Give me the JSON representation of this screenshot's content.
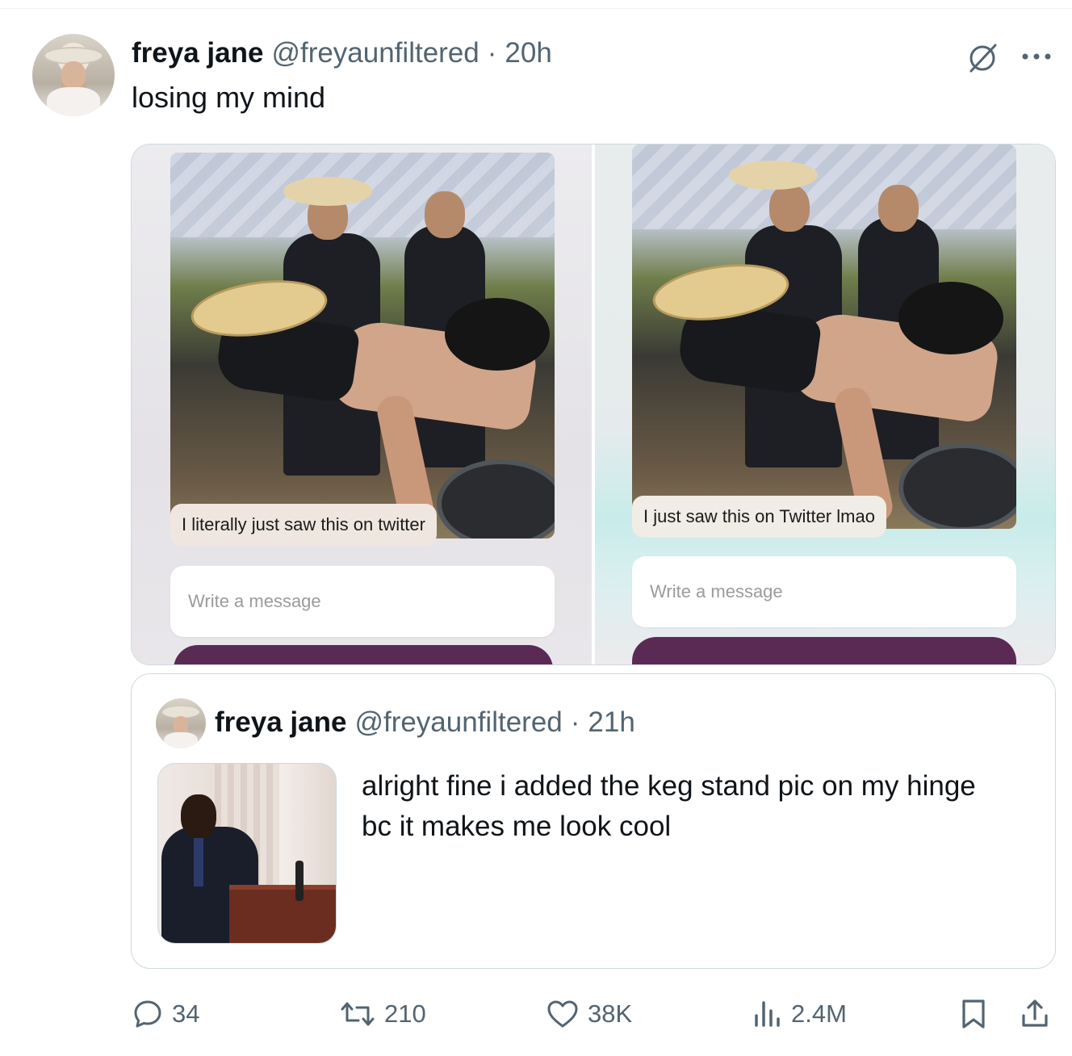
{
  "tweet": {
    "author_name": "freya jane",
    "handle": "@freyaunfiltered",
    "separator": "·",
    "time": "20h",
    "text": "losing my mind"
  },
  "media": {
    "left": {
      "bubble": "I literally just saw this on twitter",
      "input_placeholder": "Write a message"
    },
    "right": {
      "bubble": "I just saw this on Twitter lmao",
      "input_placeholder": "Write a message"
    }
  },
  "quote": {
    "author_name": "freya jane",
    "handle": "@freyaunfiltered",
    "separator": "·",
    "time": "21h",
    "text": "alright fine i added the keg stand pic on my hinge bc it makes me look cool"
  },
  "actions": {
    "replies": "34",
    "reposts": "210",
    "likes": "38K",
    "views": "2.4M"
  },
  "colors": {
    "text": "#0f1419",
    "secondary": "#536471",
    "border": "#cfd9de",
    "cta_purple": "#5a2a55"
  }
}
